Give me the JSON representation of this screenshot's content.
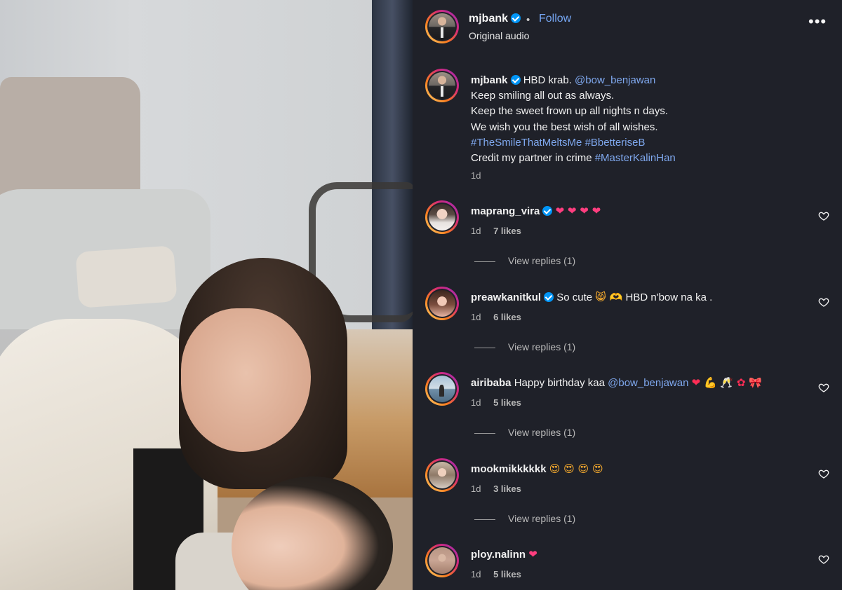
{
  "post": {
    "author": "mjbank",
    "follow_label": "Follow",
    "separator": "•",
    "audio": "Original audio",
    "more_label": "•••",
    "caption": {
      "text_prefix": "HBD krab.",
      "mention": "@bow_benjawan",
      "line2": "Keep smiling all out as always.",
      "line3": "Keep the sweet frown up all nights n days.",
      "line4": "We wish you the best wish of all wishes.",
      "hashtag1": "#TheSmileThatMeltsMe",
      "hashtag2": "#BbetteriseB",
      "line6_prefix": "Credit my partner in crime",
      "hashtag3": "#MasterKalinHan",
      "time": "1d"
    }
  },
  "comments": [
    {
      "user": "maprang_vira",
      "verified": true,
      "text": "",
      "emoji": "❤ ❤ ❤ ❤",
      "time": "1d",
      "likes": "7 likes",
      "replies": "View replies (1)"
    },
    {
      "user": "preawkanitkul",
      "verified": true,
      "text": "So cute",
      "emoji_mid": "😸 🫶",
      "text2": "HBD n'bow na ka .",
      "time": "1d",
      "likes": "6 likes",
      "replies": "View replies (1)"
    },
    {
      "user": "airibaba",
      "verified": false,
      "text": "Happy birthday kaa",
      "mention": "@bow_benjawan",
      "emoji": "❤ 💪 🥂 ✿ 🎀",
      "time": "1d",
      "likes": "5 likes",
      "replies": "View replies (1)"
    },
    {
      "user": "mookmikkkkkk",
      "verified": false,
      "text": "",
      "emoji": "😍 😍 😍 😍",
      "time": "1d",
      "likes": "3 likes",
      "replies": "View replies (1)"
    },
    {
      "user": "ploy.nalinn",
      "verified": false,
      "text": "",
      "emoji": "❤",
      "time": "1d",
      "likes": "5 likes",
      "replies": ""
    }
  ],
  "colors": {
    "panel_bg": "#1f2129",
    "link": "#7fa8ee",
    "follow": "#76a7f4",
    "verified": "#0095f6"
  },
  "icons": [
    "verified-badge-icon",
    "more-options-icon",
    "heart-icon"
  ]
}
